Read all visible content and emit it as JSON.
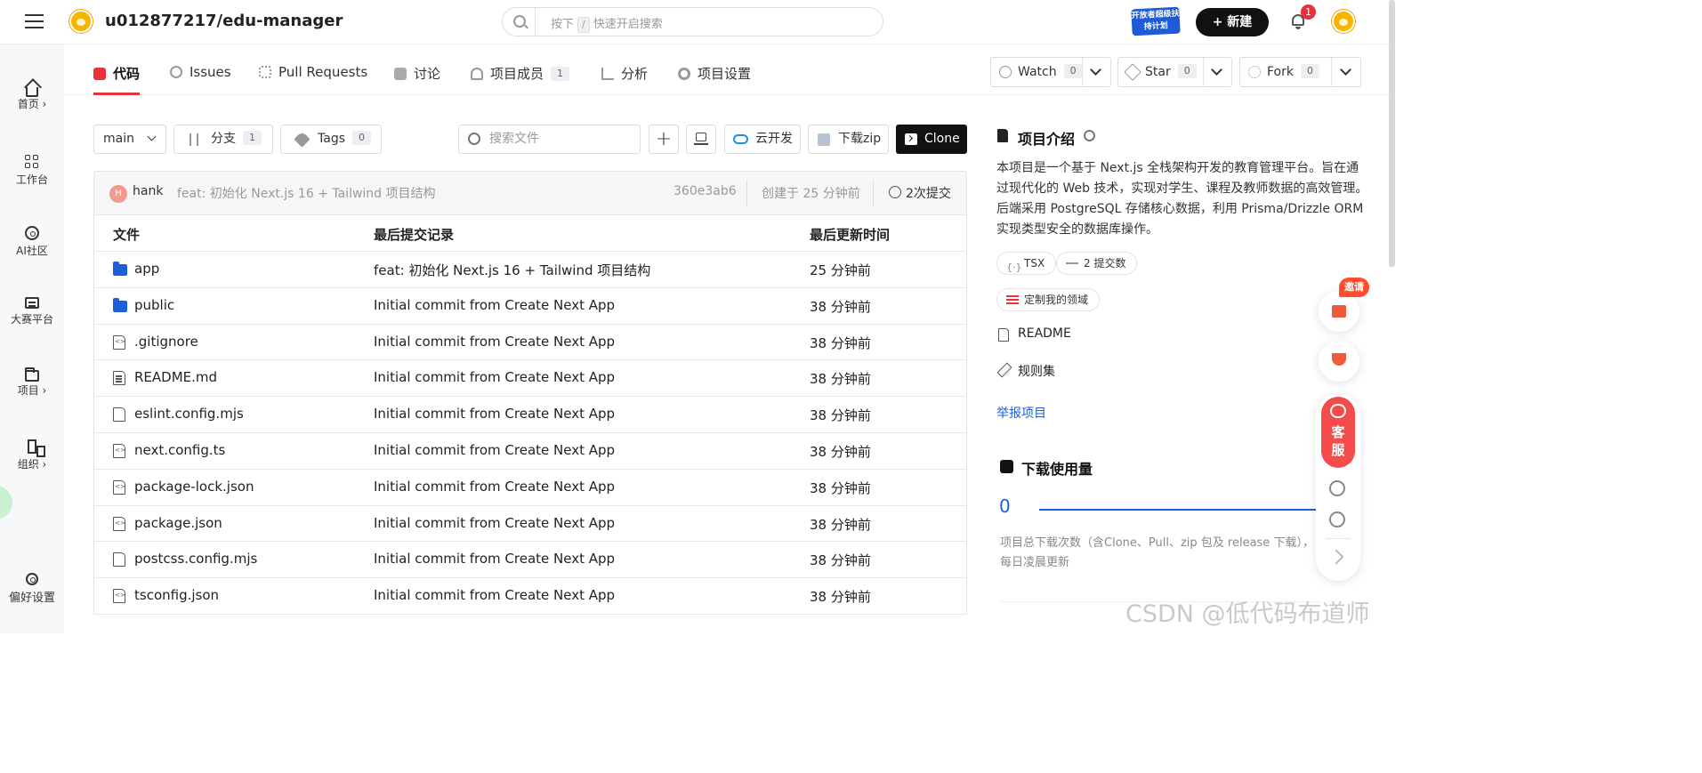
{
  "header": {
    "repo_title": "u012877217/edu-manager",
    "search_prefix": "按下",
    "search_key": "/",
    "search_suffix": "快速开启搜索",
    "promo_text": "开放者超级扶持计划",
    "new_button": "+ 新建",
    "notification_count": "1"
  },
  "leftnav": [
    {
      "label": "首页 ›",
      "icon": "home-icon"
    },
    {
      "label": "工作台",
      "icon": "grid-icon"
    },
    {
      "label": "AI社区",
      "icon": "ai-icon"
    },
    {
      "label": "大赛平台",
      "icon": "competition-icon"
    },
    {
      "label": "项目 ›",
      "icon": "folder-icon"
    },
    {
      "label": "组织 ›",
      "icon": "org-icon"
    },
    {
      "label": "偏好设置",
      "icon": "gear-icon"
    }
  ],
  "tabs": [
    {
      "label": "代码",
      "active": true
    },
    {
      "label": "Issues"
    },
    {
      "label": "Pull Requests"
    },
    {
      "label": "讨论"
    },
    {
      "label": "项目成员",
      "count": "1"
    },
    {
      "label": "分析"
    },
    {
      "label": "项目设置"
    }
  ],
  "repo_actions": {
    "watch": {
      "label": "Watch",
      "count": "0"
    },
    "star": {
      "label": "Star",
      "count": "0"
    },
    "fork": {
      "label": "Fork",
      "count": "0"
    }
  },
  "toolbar": {
    "branch": "main",
    "branches_label": "分支",
    "branches_count": "1",
    "tags_label": "Tags",
    "tags_count": "0",
    "search_placeholder": "搜索文件",
    "cloud_dev": "云开发",
    "download_zip": "下载zip",
    "clone": "Clone"
  },
  "latest_commit": {
    "author_initial": "H",
    "author": "hank",
    "message": "feat: 初始化 Next.js 16 + Tailwind 项目结构",
    "hash": "360e3ab6",
    "created": "创建于 25 分钟前",
    "commit_count": "2次提交"
  },
  "files": {
    "headers": [
      "文件",
      "最后提交记录",
      "最后更新时间"
    ],
    "rows": [
      {
        "name": "app",
        "type": "folder",
        "commit": "feat: 初始化 Next.js 16 + Tailwind 项目结构",
        "time": "25 分钟前"
      },
      {
        "name": "public",
        "type": "folder",
        "commit": "Initial commit from Create Next App",
        "time": "38 分钟前"
      },
      {
        "name": ".gitignore",
        "type": "code",
        "commit": "Initial commit from Create Next App",
        "time": "38 分钟前"
      },
      {
        "name": "README.md",
        "type": "doc",
        "commit": "Initial commit from Create Next App",
        "time": "38 分钟前"
      },
      {
        "name": "eslint.config.mjs",
        "type": "file",
        "commit": "Initial commit from Create Next App",
        "time": "38 分钟前"
      },
      {
        "name": "next.config.ts",
        "type": "code",
        "commit": "Initial commit from Create Next App",
        "time": "38 分钟前"
      },
      {
        "name": "package-lock.json",
        "type": "code",
        "commit": "Initial commit from Create Next App",
        "time": "38 分钟前"
      },
      {
        "name": "package.json",
        "type": "code",
        "commit": "Initial commit from Create Next App",
        "time": "38 分钟前"
      },
      {
        "name": "postcss.config.mjs",
        "type": "file",
        "commit": "Initial commit from Create Next App",
        "time": "38 分钟前"
      },
      {
        "name": "tsconfig.json",
        "type": "code",
        "commit": "Initial commit from Create Next App",
        "time": "38 分钟前"
      }
    ]
  },
  "sidebar": {
    "intro_title": "项目介绍",
    "intro_text": "本项目是一个基于 Next.js 全栈架构开发的教育管理平台。旨在通过现代化的 Web 技术，实现对学生、课程及教师数据的高效管理。后端采用 PostgreSQL 存储核心数据，利用 Prisma/Drizzle ORM 实现类型安全的数据库操作。",
    "lang_chip": "TSX",
    "commits_chip": "2 提交数",
    "domain_chip": "定制我的领域",
    "readme": "README",
    "rules": "规则集",
    "report": "举报项目",
    "downloads_title": "下载使用量",
    "downloads_value": "0",
    "downloads_note": "项目总下载次数（含Clone、Pull、zip 包及 release 下载），每日凌晨更新"
  },
  "floating": {
    "invite": "邀请",
    "service": "客服"
  },
  "watermark": "CSDN @低代码布道师",
  "colors": {
    "accent_red": "#e8313a",
    "folder_blue": "#1d5fd8",
    "dark_button": "#111111"
  }
}
